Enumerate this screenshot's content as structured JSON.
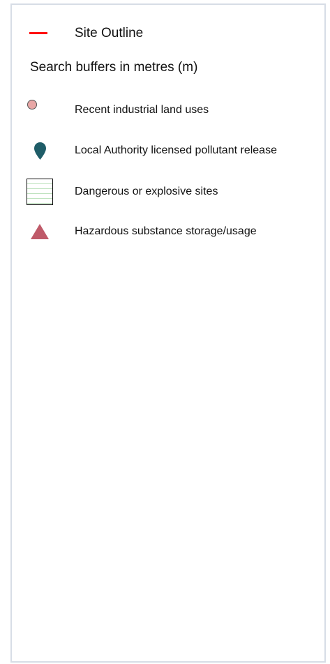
{
  "legend": {
    "site_outline": {
      "label": "Site Outline",
      "color": "#ff1010"
    },
    "search_buffers_label": "Search buffers in metres (m)",
    "items": [
      {
        "label": "Recent industrial land uses",
        "icon": "pink-circle-icon",
        "color": "#e8a7a6"
      },
      {
        "label": "Local Authority licensed pollutant release",
        "icon": "teal-pin-icon",
        "color": "#1f5d68"
      },
      {
        "label": "Dangerous or explosive sites",
        "icon": "green-hatched-square-icon",
        "color": "#bfe3bf"
      },
      {
        "label": "Hazardous substance storage/usage",
        "icon": "red-triangle-icon",
        "color": "#bf5a69"
      }
    ]
  }
}
